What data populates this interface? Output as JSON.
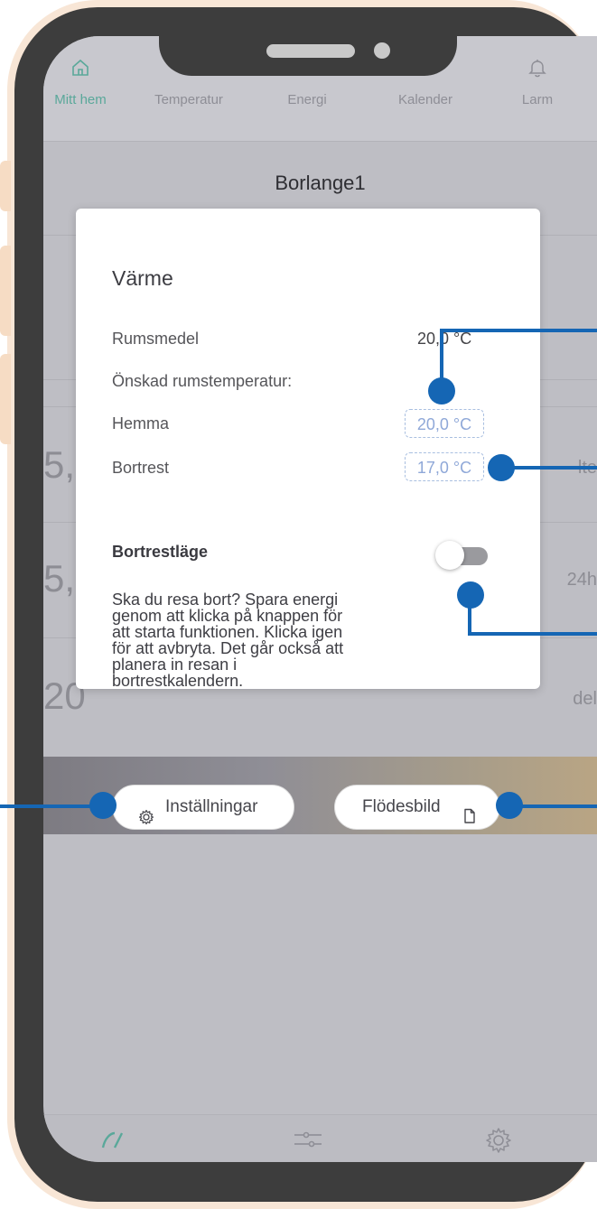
{
  "topnav": {
    "items": [
      {
        "label": "Mitt hem",
        "icon": "home-icon",
        "active": true
      },
      {
        "label": "Temperatur",
        "icon": "thermometer-icon",
        "active": false
      },
      {
        "label": "Energi",
        "icon": "energy-icon",
        "active": false
      },
      {
        "label": "Kalender",
        "icon": "calendar-icon",
        "active": false
      },
      {
        "label": "Larm",
        "icon": "bell-icon",
        "active": false
      }
    ]
  },
  "page": {
    "title": "Borlange1"
  },
  "background_rows": [
    {
      "big": "5,",
      "side": "lte"
    },
    {
      "big": "5,",
      "side": "24h"
    },
    {
      "big": "20",
      "side": "del"
    }
  ],
  "dialog": {
    "title": "Värme",
    "rumsmedel_label": "Rumsmedel",
    "rumsmedel_value": "20,0 °C",
    "desired_label": "Önskad rumstemperatur:",
    "home_label": "Hemma",
    "home_value": "20,0 °C",
    "away_label": "Bortrest",
    "away_value": "17,0 °C",
    "mode_title": "Bortrestläge",
    "mode_enabled": false,
    "description_lines": [
      "Ska du resa bort? Spara energi",
      "genom att klicka på knappen för",
      "att starta funktionen. Klicka igen",
      "för att avbryta. Det går också att",
      "planera in resan i",
      "bortrestkalendern."
    ],
    "settings_button": "Inställningar",
    "flow_button": "Flödesbild"
  },
  "bottom_nav": {
    "items": [
      {
        "icon": "gauge-icon",
        "active": true
      },
      {
        "icon": "sliders-icon",
        "active": false
      },
      {
        "icon": "gear-icon",
        "active": false
      }
    ]
  },
  "colors": {
    "accent": "#5aa89a",
    "callout": "#1566b4",
    "temp_box": "#8fa8d8",
    "phone_frame": "#3d3d3d",
    "phone_outline": "#f8e6d6"
  }
}
